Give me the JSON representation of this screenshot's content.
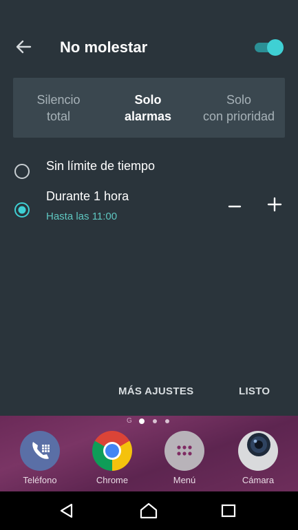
{
  "dialog": {
    "title": "No molestar",
    "toggle_on": true,
    "modes": [
      {
        "line1": "Silencio",
        "line2": "total",
        "selected": false
      },
      {
        "line1": "Solo",
        "line2": "alarmas",
        "selected": true
      },
      {
        "line1": "Solo",
        "line2": "con prioridad",
        "selected": false
      }
    ],
    "options": [
      {
        "label": "Sin límite de tiempo",
        "selected": false
      },
      {
        "label": "Durante 1 hora",
        "sublabel": "Hasta las 11:00",
        "selected": true
      }
    ],
    "more_settings_label": "MÁS AJUSTES",
    "done_label": "LISTO"
  },
  "home": {
    "page_indicator": "G",
    "apps": [
      {
        "name": "Teléfono",
        "icon": "phone-icon"
      },
      {
        "name": "Chrome",
        "icon": "chrome-icon"
      },
      {
        "name": "Menú",
        "icon": "app-drawer-icon"
      },
      {
        "name": "Cámara",
        "icon": "camera-icon"
      }
    ]
  },
  "colors": {
    "accent": "#3fd0d4",
    "sublabel": "#5fc7c1",
    "panel": "#2a343b",
    "segment": "#3a474f"
  }
}
